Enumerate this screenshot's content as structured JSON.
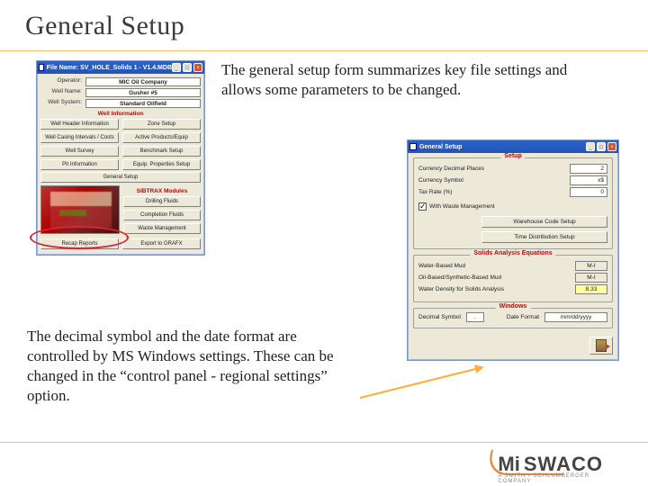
{
  "title": "General Setup",
  "para1": "The general setup form summarizes key file settings and allows some parameters to be changed.",
  "para2": "The decimal symbol and the date format are controlled by MS Windows settings. These can be changed in the “control panel - regional settings” option.",
  "logo": {
    "mi": "Mi",
    "swaco": "SWACO",
    "sub": "A SMITH / SCHLUMBERGER COMPANY"
  },
  "w1": {
    "title": "File Name: SV_HOLE_Solids 1 - V1.4.MDB",
    "kv": {
      "operator_k": "Operator:",
      "operator_v": "MIC Oil Company",
      "wellname_k": "Well Name:",
      "wellname_v": "Gusher #5",
      "wellsys_k": "Well System:",
      "wellsys_v": "Standard Oilfield"
    },
    "sect1": "Well Information",
    "btns1": [
      "Well Header Information",
      "Zone Setup",
      "Well Casing Intervals / Costs",
      "Active Products/Equip",
      "Well Survey",
      "Benchmark Setup",
      "Pit Information",
      "Equip. Properties Setup"
    ],
    "general": "General Setup",
    "sect2": "SIBTRAX Modules",
    "mods": [
      "Drilling Fluids",
      "Completion Fluids",
      "Waste Management"
    ],
    "recap": "Recap Reports",
    "export": "Export to GRAFX"
  },
  "w2": {
    "title": "General Setup",
    "g1": {
      "legend": "Setup",
      "r1": "Currency Decimal Places",
      "r1v": "2",
      "r2": "Currency Symbol",
      "r2v": "x$",
      "r3": "Tax Rate (%)",
      "r3v": "0",
      "chk": "With Waste Management",
      "b1": "Warehouse Code Setup",
      "b2": "Time Distribution Setup"
    },
    "g2": {
      "legend": "Solids Analysis Equations",
      "r1": "Water-Based Mud",
      "r1v": "M-I",
      "r2": "Oil-Based/Synthetic-Based Mud",
      "r2v": "M-I",
      "r3": "Water Density for Solids Analysis",
      "r3v": "8.33"
    },
    "g3": {
      "legend": "Windows",
      "l1": "Decimal Symbol",
      "v1": ".",
      "l2": "Date Format",
      "v2": "mm/dd/yyyy"
    }
  }
}
